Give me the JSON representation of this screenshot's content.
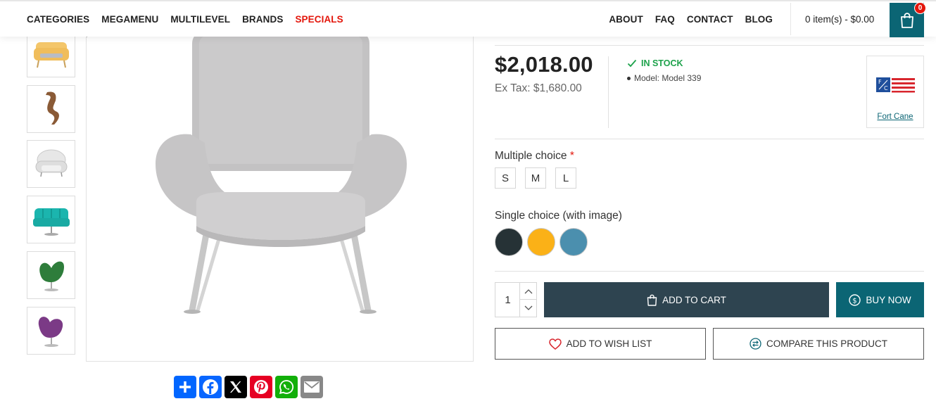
{
  "nav": {
    "left": [
      "CATEGORIES",
      "MEGAMENU",
      "MULTILEVEL",
      "BRANDS",
      "SPECIALS"
    ],
    "right": [
      "ABOUT",
      "FAQ",
      "CONTACT",
      "BLOG"
    ],
    "cart_text": "0 item(s) - $0.00",
    "cart_badge": "0"
  },
  "thumbnails": [
    "yellow-sofa",
    "wooden-curved-chair",
    "white-armchair",
    "teal-tufted-chair",
    "green-egg-chair",
    "purple-egg-chair"
  ],
  "product": {
    "price": "$2,018.00",
    "ex_tax": "Ex Tax: $1,680.00",
    "stock": "IN STOCK",
    "model": "Model: Model 339",
    "brand": "Fort Cane"
  },
  "options": {
    "multiple_label": "Multiple choice",
    "required_mark": "*",
    "sizes": [
      "S",
      "M",
      "L"
    ],
    "single_label": "Single choice (with image)",
    "colors": [
      "#263236",
      "#fbb117",
      "#4b8fae"
    ]
  },
  "cart": {
    "quantity": "1",
    "add_to_cart": "ADD TO CART",
    "buy_now": "BUY NOW",
    "wishlist": "ADD TO WISH LIST",
    "compare": "COMPARE THIS PRODUCT"
  },
  "share": [
    "add",
    "facebook",
    "x",
    "pinterest",
    "whatsapp",
    "email"
  ],
  "colors": {
    "accent": "#0b6574",
    "cart_button": "#2e4450",
    "special": "#e3160b",
    "in_stock": "#1da24b"
  }
}
